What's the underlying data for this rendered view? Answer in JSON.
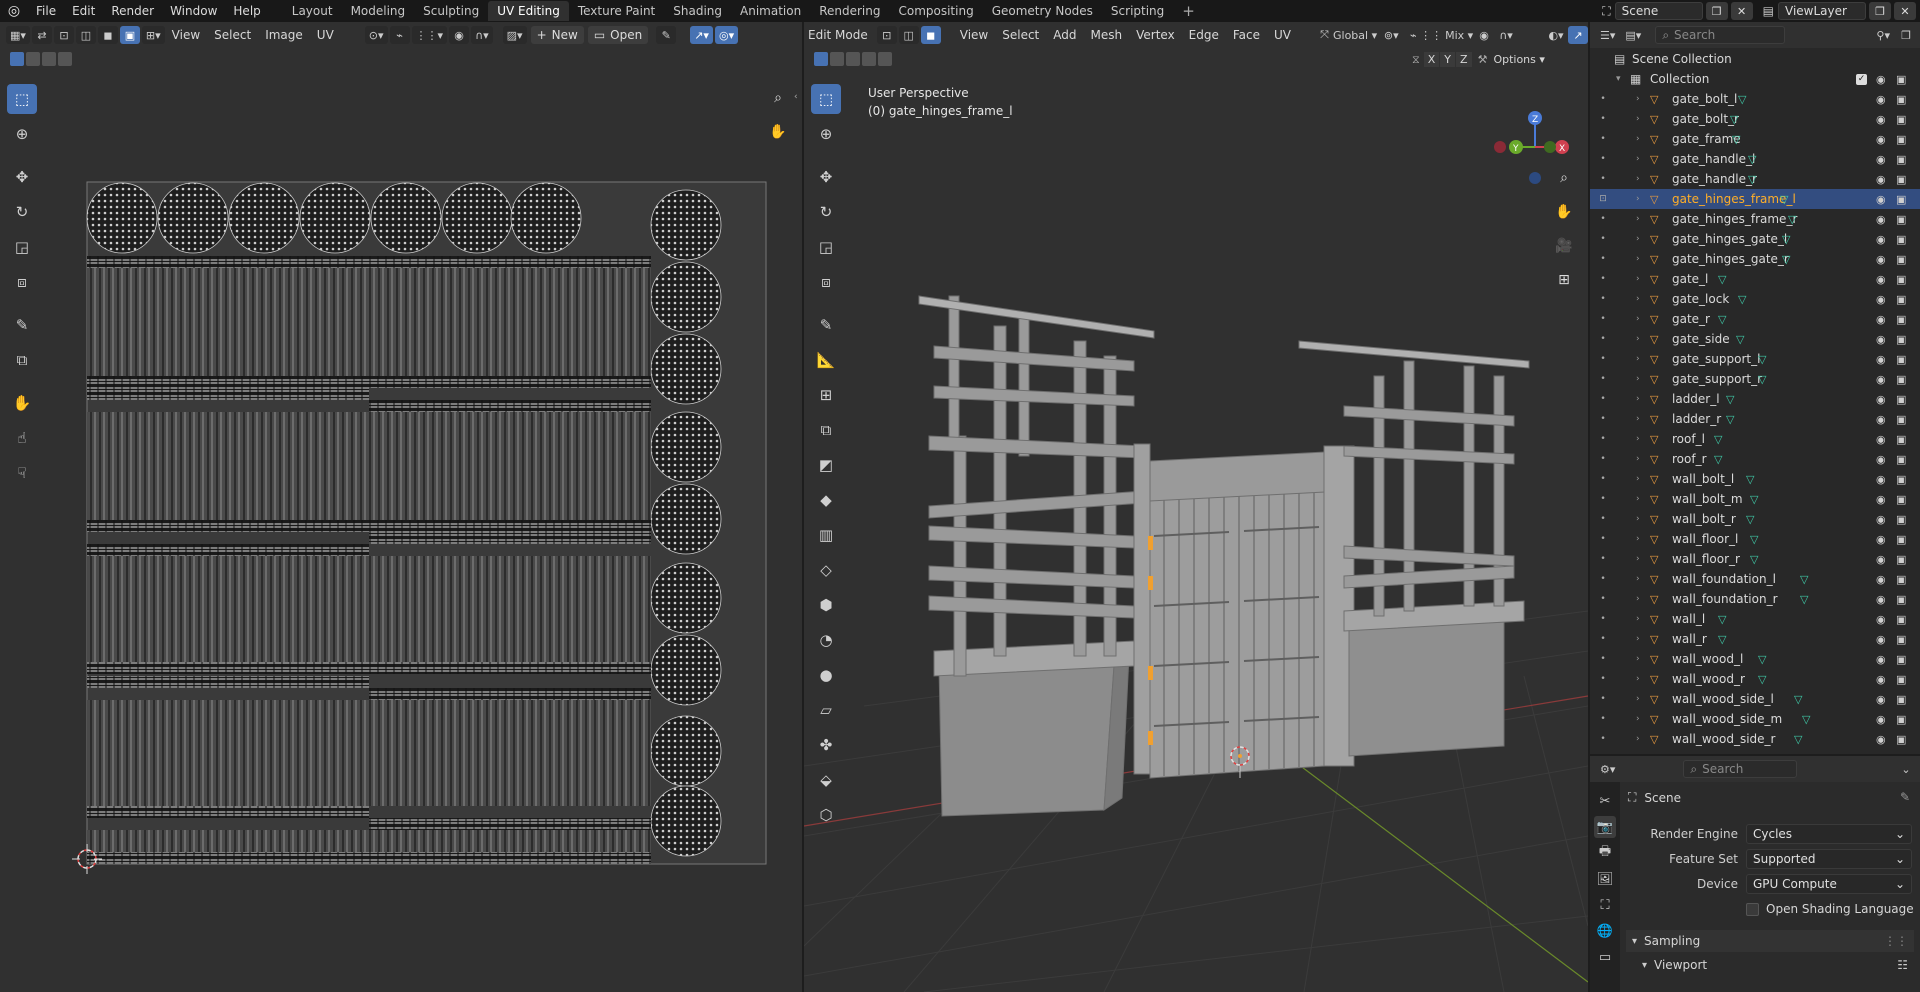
{
  "topbar": {
    "menus": [
      "File",
      "Edit",
      "Render",
      "Window",
      "Help"
    ],
    "workspaces": [
      "Layout",
      "Modeling",
      "Sculpting",
      "UV Editing",
      "Texture Paint",
      "Shading",
      "Animation",
      "Rendering",
      "Compositing",
      "Geometry Nodes",
      "Scripting"
    ],
    "active_workspace": "UV Editing",
    "scene": "Scene",
    "view_layer": "ViewLayer"
  },
  "uv_editor": {
    "menus": [
      "View",
      "Select",
      "Image",
      "UV"
    ],
    "new_label": "New",
    "open_label": "Open"
  },
  "viewport": {
    "mode": "Edit Mode",
    "menus": [
      "View",
      "Select",
      "Add",
      "Mesh",
      "Vertex",
      "Edge",
      "Face",
      "UV"
    ],
    "orientation": "Global",
    "snap_mix": "Mix",
    "options_label": "Options",
    "axes": [
      "X",
      "Y",
      "Z"
    ],
    "overlay_line1": "User Perspective",
    "overlay_line2": "(0) gate_hinges_frame_l"
  },
  "outliner": {
    "search_placeholder": "Search",
    "scene_collection": "Scene Collection",
    "collection": "Collection",
    "selected": "gate_hinges_frame_l",
    "objects": [
      "gate_bolt_l",
      "gate_bolt_r",
      "gate_frame",
      "gate_handle_l",
      "gate_handle_r",
      "gate_hinges_frame_l",
      "gate_hinges_frame_r",
      "gate_hinges_gate_l",
      "gate_hinges_gate_r",
      "gate_l",
      "gate_lock",
      "gate_r",
      "gate_side",
      "gate_support_l",
      "gate_support_r",
      "ladder_l",
      "ladder_r",
      "roof_l",
      "roof_r",
      "wall_bolt_l",
      "wall_bolt_m",
      "wall_bolt_r",
      "wall_floor_l",
      "wall_floor_r",
      "wall_foundation_l",
      "wall_foundation_r",
      "wall_l",
      "wall_r",
      "wall_wood_l",
      "wall_wood_r",
      "wall_wood_side_l",
      "wall_wood_side_m",
      "wall_wood_side_r"
    ]
  },
  "properties": {
    "search_placeholder": "Search",
    "context": "Scene",
    "render_engine_label": "Render Engine",
    "render_engine": "Cycles",
    "feature_set_label": "Feature Set",
    "feature_set": "Supported",
    "device_label": "Device",
    "device": "GPU Compute",
    "osl_label": "Open Shading Language",
    "sampling_label": "Sampling",
    "viewport_label": "Viewport"
  },
  "colors": {
    "accent": "#4772b3",
    "selected_text": "#ffaf29",
    "mesh_icon": "#3fc8a6",
    "object_icon": "#e89a40"
  }
}
